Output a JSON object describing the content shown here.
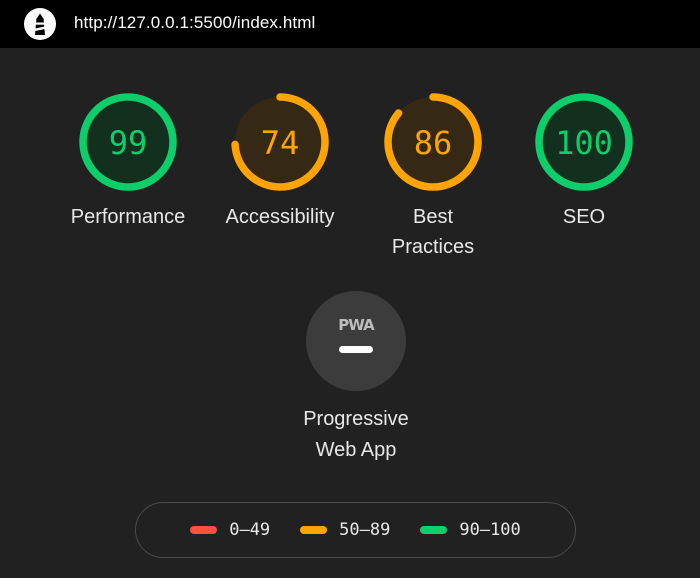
{
  "topbar": {
    "url": "http://127.0.0.1:5500/index.html",
    "logo_icon": "lighthouse-icon"
  },
  "gauges": [
    {
      "id": "performance",
      "score": "99",
      "value": 99,
      "label": "Performance",
      "color": "#0cce6b",
      "fill": "#13301f"
    },
    {
      "id": "accessibility",
      "score": "74",
      "value": 74,
      "label": "Accessibility",
      "color": "#ffa400",
      "fill": "#352915"
    },
    {
      "id": "best-practices",
      "score": "86",
      "value": 86,
      "label": "Best Practices",
      "color": "#ffa400",
      "fill": "#352915"
    },
    {
      "id": "seo",
      "score": "100",
      "value": 100,
      "label": "SEO",
      "color": "#0cce6b",
      "fill": "#13301f"
    }
  ],
  "pwa": {
    "badge_text": "PWA",
    "label": "Progressive Web App",
    "icon": "pwa-badge-icon"
  },
  "legend": [
    {
      "range": "0–49",
      "color": "#ff4e42"
    },
    {
      "range": "50–89",
      "color": "#ffa400"
    },
    {
      "range": "90–100",
      "color": "#0cce6b"
    }
  ]
}
